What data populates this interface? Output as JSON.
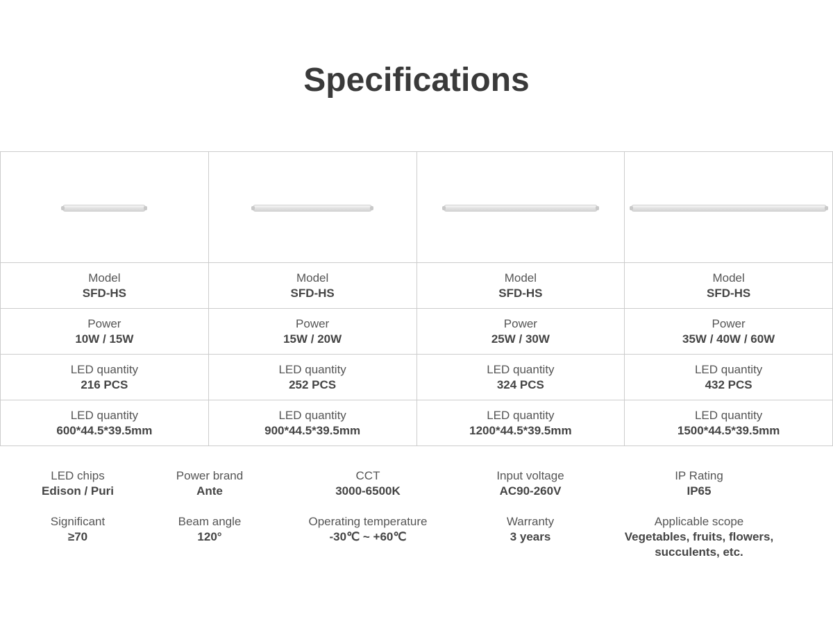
{
  "title": "Specifications",
  "products": [
    {
      "image": "tube-light-600",
      "rows": [
        {
          "label": "Model",
          "value": "SFD-HS"
        },
        {
          "label": "Power",
          "value": "10W / 15W"
        },
        {
          "label": "LED quantity",
          "value": "216 PCS"
        },
        {
          "label": "LED quantity",
          "value": "600*44.5*39.5mm"
        }
      ]
    },
    {
      "image": "tube-light-900",
      "rows": [
        {
          "label": "Model",
          "value": "SFD-HS"
        },
        {
          "label": "Power",
          "value": "15W / 20W"
        },
        {
          "label": "LED quantity",
          "value": "252 PCS"
        },
        {
          "label": "LED quantity",
          "value": "900*44.5*39.5mm"
        }
      ]
    },
    {
      "image": "tube-light-1200",
      "rows": [
        {
          "label": "Model",
          "value": "SFD-HS"
        },
        {
          "label": "Power",
          "value": "25W / 30W"
        },
        {
          "label": "LED quantity",
          "value": "324 PCS"
        },
        {
          "label": "LED quantity",
          "value": "1200*44.5*39.5mm"
        }
      ]
    },
    {
      "image": "tube-light-1500",
      "rows": [
        {
          "label": "Model",
          "value": "SFD-HS"
        },
        {
          "label": "Power",
          "value": "35W / 40W / 60W"
        },
        {
          "label": "LED quantity",
          "value": "432 PCS"
        },
        {
          "label": "LED quantity",
          "value": "1500*44.5*39.5mm"
        }
      ]
    }
  ],
  "common_specs": [
    {
      "label": "LED chips",
      "value": "Edison / Puri"
    },
    {
      "label": "Power brand",
      "value": "Ante"
    },
    {
      "label": "CCT",
      "value": "3000-6500K"
    },
    {
      "label": "Input voltage",
      "value": "AC90-260V"
    },
    {
      "label": "IP Rating",
      "value": "IP65"
    },
    {
      "label": "Significant",
      "value": "≥70"
    },
    {
      "label": "Beam angle",
      "value": "120°"
    },
    {
      "label": "Operating temperature",
      "value": "-30℃ ~ +60℃"
    },
    {
      "label": "Warranty",
      "value": "3 years"
    },
    {
      "label": "Applicable scope",
      "value": "Vegetables, fruits, flowers, succulents, etc."
    }
  ]
}
